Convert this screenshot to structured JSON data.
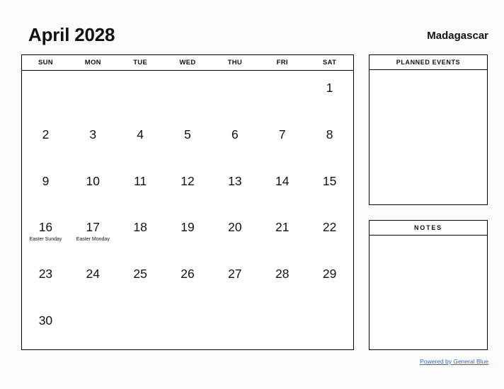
{
  "header": {
    "title": "April 2028",
    "country": "Madagascar"
  },
  "calendar": {
    "weekday_headers": [
      "SUN",
      "MON",
      "TUE",
      "WED",
      "THU",
      "FRI",
      "SAT"
    ],
    "weeks": [
      [
        {
          "day": ""
        },
        {
          "day": ""
        },
        {
          "day": ""
        },
        {
          "day": ""
        },
        {
          "day": ""
        },
        {
          "day": ""
        },
        {
          "day": "1"
        }
      ],
      [
        {
          "day": "2"
        },
        {
          "day": "3"
        },
        {
          "day": "4"
        },
        {
          "day": "5"
        },
        {
          "day": "6"
        },
        {
          "day": "7"
        },
        {
          "day": "8"
        }
      ],
      [
        {
          "day": "9"
        },
        {
          "day": "10"
        },
        {
          "day": "11"
        },
        {
          "day": "12"
        },
        {
          "day": "13"
        },
        {
          "day": "14"
        },
        {
          "day": "15"
        }
      ],
      [
        {
          "day": "16",
          "note": "Easter Sunday"
        },
        {
          "day": "17",
          "note": "Easter Monday"
        },
        {
          "day": "18"
        },
        {
          "day": "19"
        },
        {
          "day": "20"
        },
        {
          "day": "21"
        },
        {
          "day": "22"
        }
      ],
      [
        {
          "day": "23"
        },
        {
          "day": "24"
        },
        {
          "day": "25"
        },
        {
          "day": "26"
        },
        {
          "day": "27"
        },
        {
          "day": "28"
        },
        {
          "day": "29"
        }
      ],
      [
        {
          "day": "30"
        },
        {
          "day": ""
        },
        {
          "day": ""
        },
        {
          "day": ""
        },
        {
          "day": ""
        },
        {
          "day": ""
        },
        {
          "day": ""
        }
      ]
    ]
  },
  "panels": [
    {
      "title": "PLANNED EVENTS",
      "content": ""
    },
    {
      "title": "NOTES",
      "content": ""
    }
  ],
  "footer": {
    "link_text": "Powered by General Blue"
  },
  "colors": {
    "page_background": "#fcfcfc",
    "border": "#000000",
    "text": "#111111",
    "link": "#3366cc"
  }
}
